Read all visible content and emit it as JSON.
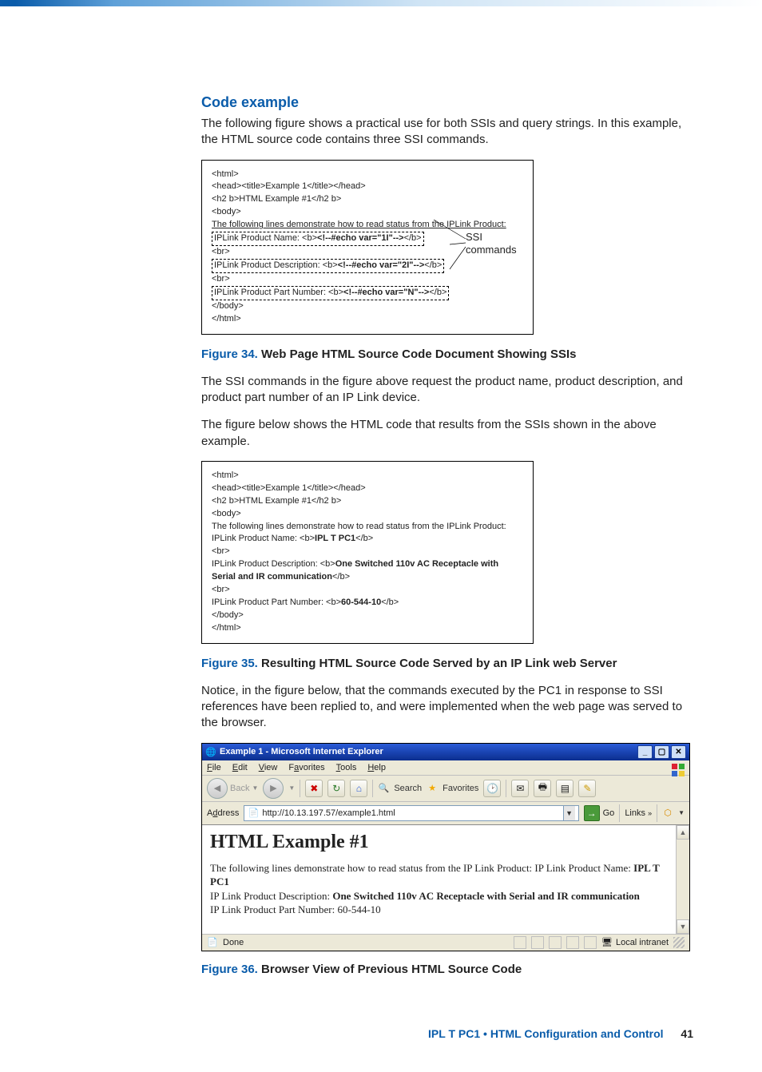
{
  "heading": "Code example",
  "intro": "The following figure shows a practical use for both SSIs and query strings. In this example, the HTML source code contains three SSI commands.",
  "code1": {
    "annotation": "SSI\ncommands",
    "lines": [
      "<html>",
      "<head><title>Example 1</title></head>",
      "<h2 b>HTML Example #1</h2 b>",
      "<body>"
    ],
    "under": "The following lines demonstrate how to read status from the IPLink Product:",
    "d1_pre": "IPLink Product Name: <b>",
    "d1_bold": "<!--#echo var=\"1I\"-->",
    "d1_post": "</b>",
    "br": "<br>",
    "d2_pre": "IPLink Product Description: <b>",
    "d2_bold": "<!--#echo var=\"2I\"-->",
    "d2_post": "</b>",
    "d3_pre": "IPLink Product Part Number: <b>",
    "d3_bold": "<!--#echo var=\"N\"-->",
    "d3_post": "</b>",
    "close1": "</body>",
    "close2": "</html>"
  },
  "fig34": {
    "num": "Figure 34.",
    "title": "Web Page HTML Source Code Document Showing SSIs"
  },
  "p1": "The SSI commands in the figure above request the product name, product description, and product part number of an IP Link device.",
  "p2": "The figure below shows the HTML code that results from the SSIs shown in the above example.",
  "code2": {
    "lines_top": [
      "<html>",
      "<head><title>Example 1</title></head>",
      "<h2 b>HTML Example #1</h2 b>",
      "<body>",
      "The following lines demonstrate how to read status from the IPLink Product:"
    ],
    "l_name_pre": "IPLink Product Name: <b>",
    "l_name_val": "IPL T PC1",
    "l_name_post": "</b>",
    "br": "<br>",
    "l_desc_pre": "IPLink Product Description: <b>",
    "l_desc_val": "One Switched 110v AC Receptacle with Serial and IR communication",
    "l_desc_post": "</b>",
    "l_pn_pre": "IPLink Product Part Number: <b>",
    "l_pn_val": "60-544-10",
    "l_pn_post": "</b>",
    "close1": "</body>",
    "close2": "</html>"
  },
  "fig35": {
    "num": "Figure 35.",
    "title": "Resulting HTML Source Code Served by an IP Link web Server"
  },
  "p3": "Notice, in the figure below, that the commands executed by the PC1 in response to SSI references have been replied to, and were implemented when the web page was served to the browser.",
  "ie": {
    "title": "Example 1 - Microsoft Internet Explorer",
    "menus": {
      "file": "File",
      "edit": "Edit",
      "view": "View",
      "fav": "Favorites",
      "tools": "Tools",
      "help": "Help"
    },
    "toolbar": {
      "back": "Back",
      "search": "Search",
      "favorites": "Favorites"
    },
    "address_label": "Address",
    "url": "http://10.13.197.57/example1.html",
    "go": "Go",
    "links": "Links",
    "content_h2": "HTML Example #1",
    "content_pre1": "The following lines demonstrate how to read status from the IP Link Product: IP Link Product Name: ",
    "content_b1": "IPL T PC1",
    "content_pre2": "IP Link Product Description: ",
    "content_b2": "One Switched 110v AC Receptacle with Serial and IR communication",
    "content_pre3": "IP Link Product Part Number: ",
    "content_b3": "60-544-10",
    "status_done": "Done",
    "status_zone": "Local intranet"
  },
  "fig36": {
    "num": "Figure 36.",
    "title": "Browser View of Previous HTML Source Code"
  },
  "footer": {
    "text": "IPL T PC1 • HTML Configuration and Control",
    "page": "41"
  }
}
